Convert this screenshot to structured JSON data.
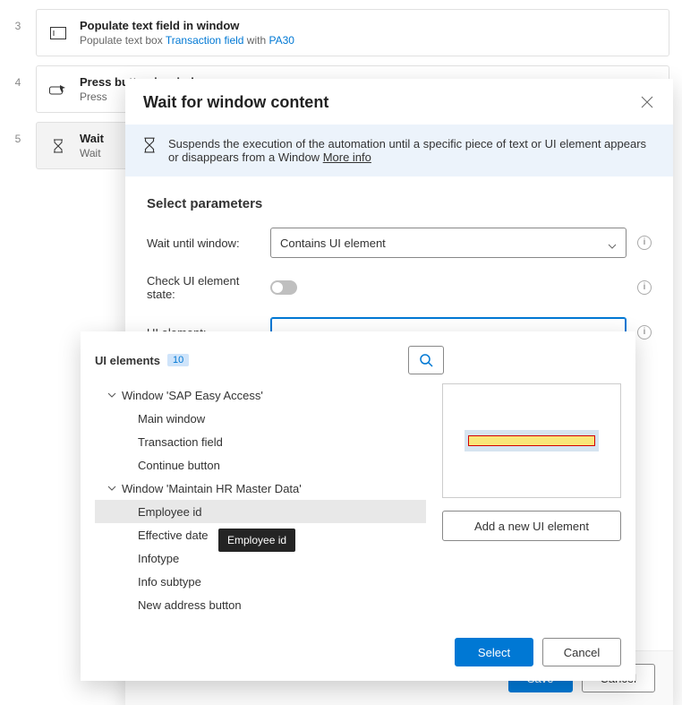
{
  "flow": {
    "steps": [
      {
        "num": "3",
        "title": "Populate text field in window",
        "sub_prefix": "Populate text box ",
        "sub_link": "Transaction field",
        "sub_mid": " with ",
        "sub_link2": "PA30"
      },
      {
        "num": "4",
        "title": "Press button in window",
        "sub_prefix": "Press ",
        "sub_link": "",
        "sub_mid": "",
        "sub_link2": ""
      },
      {
        "num": "5",
        "title": "Wait",
        "sub_prefix": "Wait ",
        "sub_link": "",
        "sub_mid": "",
        "sub_link2": ""
      }
    ]
  },
  "dialog": {
    "title": "Wait for window content",
    "description": "Suspends the execution of the automation until a specific piece of text or UI element appears or disappears from a Window ",
    "more_info": "More info",
    "params_heading": "Select parameters",
    "wait_label": "Wait until window:",
    "wait_value": "Contains UI element",
    "check_label": "Check UI element state:",
    "element_label": "UI element:",
    "element_value": "",
    "save": "Save",
    "cancel": "Cancel"
  },
  "picker": {
    "title": "UI elements",
    "count": "10",
    "groups": [
      {
        "name": "Window 'SAP Easy Access'",
        "children": [
          "Main window",
          "Transaction field",
          "Continue button"
        ]
      },
      {
        "name": "Window 'Maintain HR Master Data'",
        "children": [
          "Employee id",
          "Effective date",
          "Infotype",
          "Info subtype",
          "New address button"
        ]
      }
    ],
    "selected": "Employee id",
    "add_label": "Add a new UI element",
    "select": "Select",
    "cancel": "Cancel",
    "tooltip": "Employee id"
  }
}
